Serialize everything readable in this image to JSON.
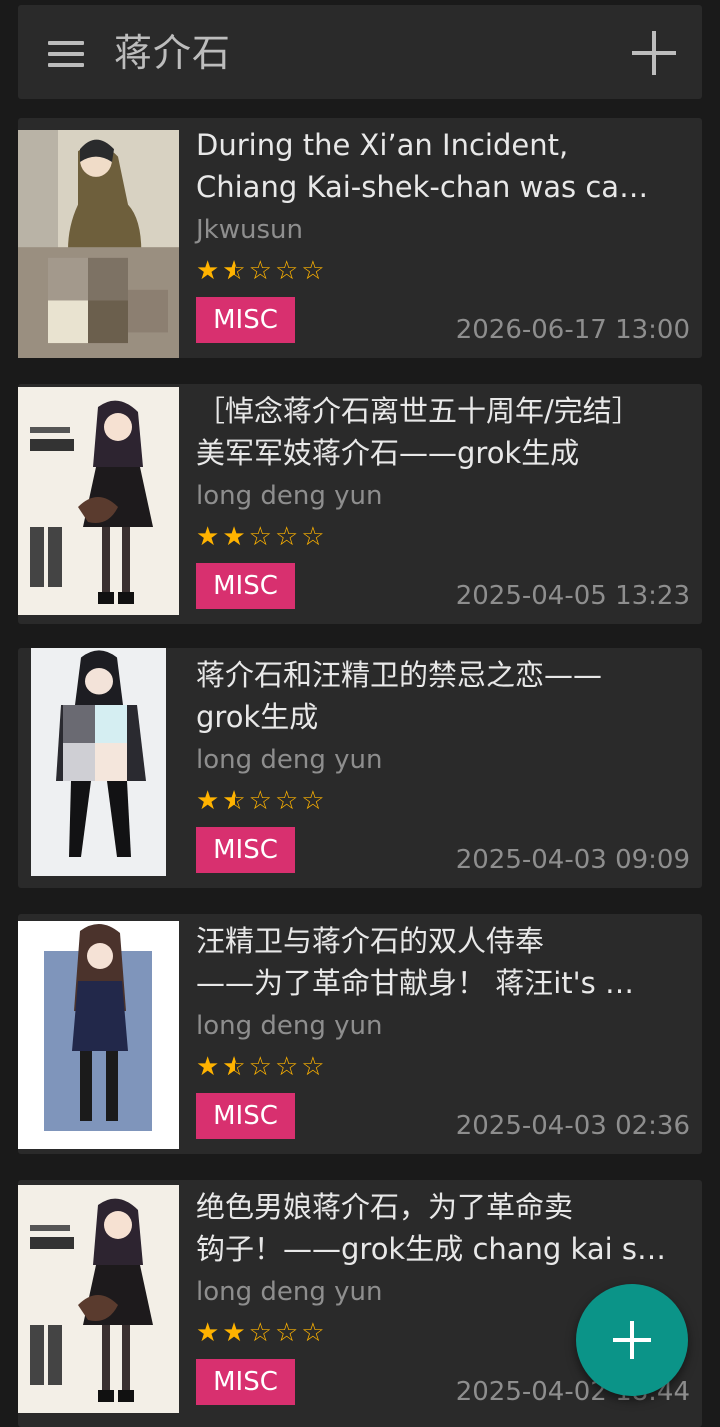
{
  "app_bar": {
    "title": "蒋介石",
    "menu_icon": "hamburger-menu-icon",
    "add_icon": "plus-icon"
  },
  "colors": {
    "background": "#1a1a1a",
    "card": "#2a2a2a",
    "category_misc": "#d8306f",
    "star": "#ffb300",
    "fab": "#0b9488"
  },
  "galleries": [
    {
      "title_line1": "During the Xi’an Incident,",
      "title_line2": "Chiang Kai-shek-chan was ca…",
      "uploader": "Jkwusun",
      "rating": 1.5,
      "category": "MISC",
      "date": "2026-06-17 13:00"
    },
    {
      "title_line1": "［悼念蒋介石离世五十周年/完结］",
      "title_line2": "美军军妓蒋介石——grok生成",
      "uploader": "long deng yun",
      "rating": 2,
      "category": "MISC",
      "date": "2025-04-05 13:23"
    },
    {
      "title_line1": "蒋介石和汪精卫的禁忌之恋——",
      "title_line2": "grok生成",
      "uploader": "long deng yun",
      "rating": 1.5,
      "category": "MISC",
      "date": "2025-04-03 09:09"
    },
    {
      "title_line1": "汪精卫与蒋介石的双人侍奉",
      "title_line2": "——为了革命甘献身！ 蒋汪it's …",
      "uploader": "long deng yun",
      "rating": 1.5,
      "category": "MISC",
      "date": "2025-04-03 02:36"
    },
    {
      "title_line1": "绝色男娘蒋介石，为了革命卖",
      "title_line2": "钩子！——grok生成 chang kai s…",
      "uploader": "long deng yun",
      "rating": 2,
      "category": "MISC",
      "date": "2025-04-02 18:44"
    }
  ],
  "fab": {
    "icon": "plus-icon"
  }
}
